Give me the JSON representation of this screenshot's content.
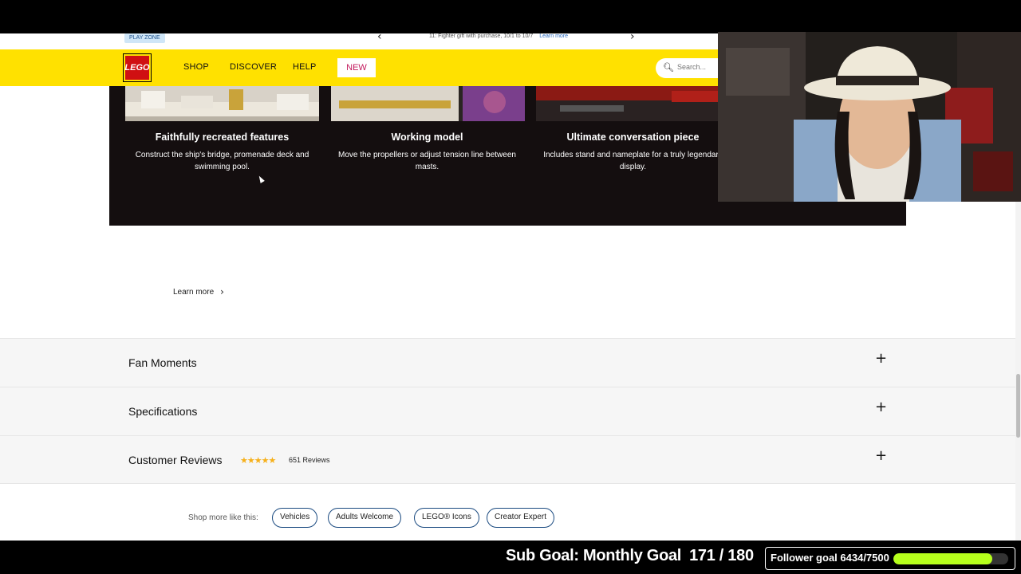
{
  "promo": {
    "play_zone": "PLAY ZONE",
    "message": "11: Fighter gift with purchase, 10/1 to 10/7",
    "learn_more": "Learn more"
  },
  "nav": {
    "logo": "LEGO",
    "shop": "SHOP",
    "discover": "DISCOVER",
    "help": "HELP",
    "new": "NEW",
    "search_placeholder": "Search..."
  },
  "features": [
    {
      "title": "Faithfully recreated features",
      "desc": "Construct the ship's bridge, promenade deck and swimming pool."
    },
    {
      "title": "Working model",
      "desc": "Move the propellers or adjust tension line between masts."
    },
    {
      "title": "Ultimate conversation piece",
      "desc": "Includes stand and nameplate for a truly legendary display."
    }
  ],
  "learn_more": "Learn more",
  "accordions": {
    "fan_moments": "Fan Moments",
    "specifications": "Specifications",
    "customer_reviews": "Customer Reviews",
    "review_count": "651 Reviews",
    "rating_stars": 4.5
  },
  "shop_more": {
    "label": "Shop more like this:",
    "chips": [
      "Vehicles",
      "Adults Welcome",
      "LEGO® Icons",
      "Creator Expert"
    ]
  },
  "stream": {
    "sub_goal_label": "Sub Goal: Monthly Goal",
    "sub_goal_count": "171 / 180",
    "follower_goal": "Follower goal 6434/7500",
    "follower_progress": 0.858
  },
  "colors": {
    "nav_yellow": "#ffe100",
    "lego_red": "#d01012",
    "dark_panel": "#140e0f",
    "star_gold": "#f6b01a",
    "chip_border": "#1a4a80",
    "progress_green": "#b6ff1c"
  }
}
